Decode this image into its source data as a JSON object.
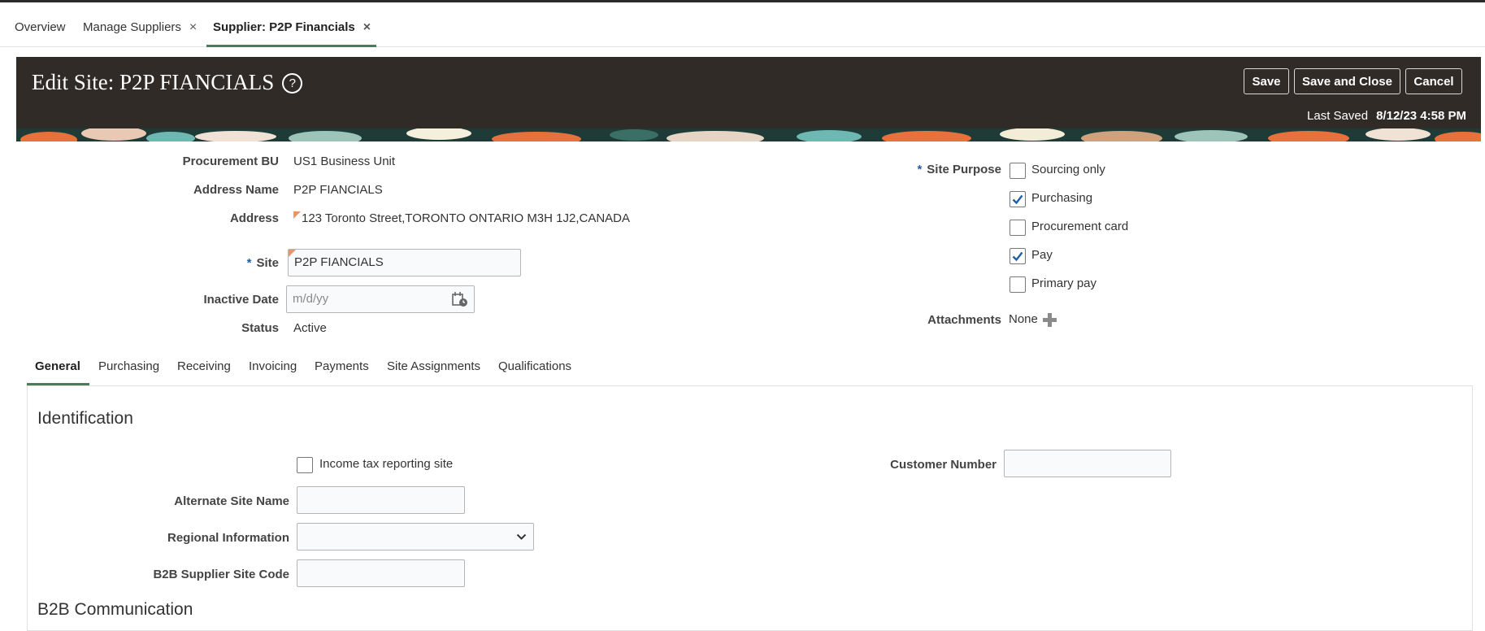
{
  "tabs": [
    {
      "label": "Overview"
    },
    {
      "label": "Manage Suppliers",
      "close": "×"
    },
    {
      "label": "Supplier: P2P Financials",
      "close": "×"
    }
  ],
  "header": {
    "title": "Edit Site: P2P FIANCIALS",
    "help_glyph": "?",
    "save_label": "Save",
    "save_close_label": "Save and Close",
    "cancel_label": "Cancel",
    "last_saved_label": "Last Saved",
    "last_saved_value": "8/12/23 4:58 PM"
  },
  "form": {
    "procurement_bu_label": "Procurement BU",
    "procurement_bu_value": "US1 Business Unit",
    "address_name_label": "Address Name",
    "address_name_value": "P2P FIANCIALS",
    "address_label": "Address",
    "address_value": "123 Toronto Street,TORONTO ONTARIO M3H 1J2,CANADA",
    "site_required": "*",
    "site_label": "Site",
    "site_value": "P2P FIANCIALS",
    "inactive_date_label": "Inactive Date",
    "inactive_date_placeholder": "m/d/yy",
    "status_label": "Status",
    "status_value": "Active",
    "site_purpose_required": "*",
    "site_purpose_label": "Site Purpose",
    "purposes": [
      {
        "label": "Sourcing only",
        "checked": false
      },
      {
        "label": "Purchasing",
        "checked": true
      },
      {
        "label": "Procurement card",
        "checked": false
      },
      {
        "label": "Pay",
        "checked": true
      },
      {
        "label": "Primary pay",
        "checked": false
      }
    ],
    "attachments_label": "Attachments",
    "attachments_value": "None"
  },
  "subtabs": [
    "General",
    "Purchasing",
    "Receiving",
    "Invoicing",
    "Payments",
    "Site Assignments",
    "Qualifications"
  ],
  "general": {
    "identification_title": "Identification",
    "income_tax_label": "Income tax reporting site",
    "income_tax_checked": false,
    "customer_number_label": "Customer Number",
    "customer_number_value": "",
    "alternate_site_name_label": "Alternate Site Name",
    "alternate_site_name_value": "",
    "regional_information_label": "Regional Information",
    "regional_information_value": "",
    "b2b_site_code_label": "B2B Supplier Site Code",
    "b2b_site_code_value": "",
    "b2b_communication_title": "B2B Communication"
  },
  "colors": {
    "header_bg": "#302b26",
    "tab_accent": "#4d7a58",
    "required": "#1f5fa8",
    "checkmark": "#1f5fa8",
    "changed_indicator": "#e8956a"
  }
}
